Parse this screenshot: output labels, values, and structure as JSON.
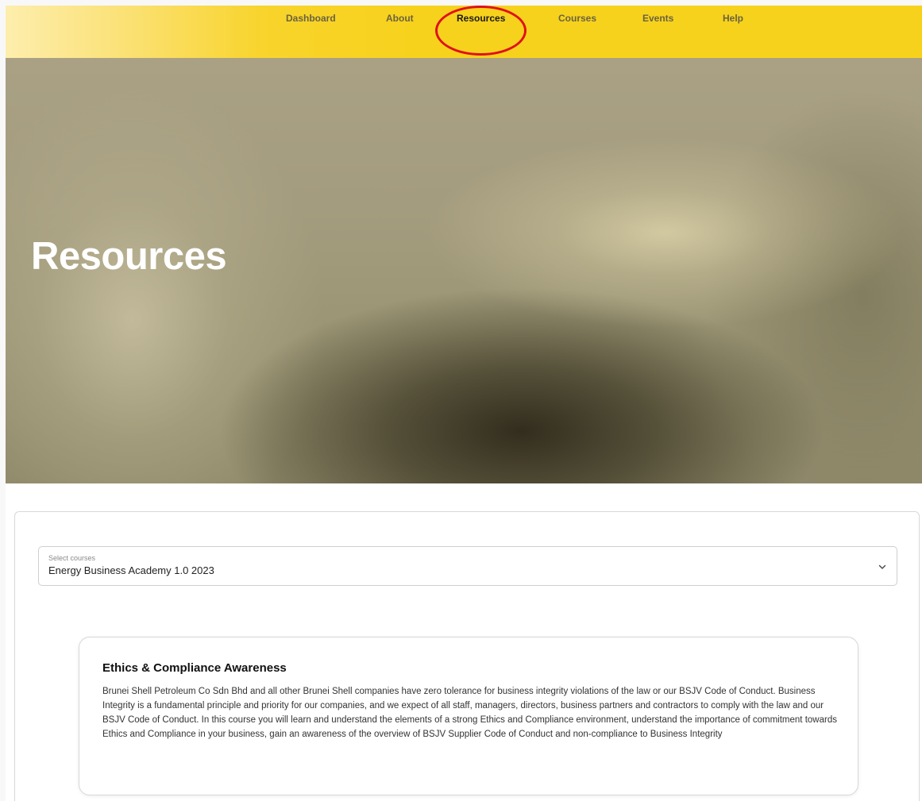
{
  "nav": {
    "items": [
      {
        "label": "Dashboard",
        "active": false
      },
      {
        "label": "About",
        "active": false
      },
      {
        "label": "Resources",
        "active": true
      },
      {
        "label": "Courses",
        "active": false
      },
      {
        "label": "Events",
        "active": false
      },
      {
        "label": "Help",
        "active": false
      }
    ]
  },
  "hero": {
    "title": "Resources"
  },
  "course_select": {
    "label": "Select courses",
    "value": "Energy Business Academy 1.0 2023",
    "icon": "chevron-down-icon"
  },
  "resource_card": {
    "title": "Ethics & Compliance Awareness",
    "description": "Brunei Shell Petroleum Co Sdn Bhd and all other Brunei Shell companies have zero tolerance for business integrity violations of the law or our BSJV Code of Conduct. Business Integrity is a fundamental principle and priority for our companies, and we expect of all staff, managers, directors, business partners and contractors to comply with the law and our BSJV Code of Conduct. In this course you will learn and understand the elements of a strong Ethics and Compliance environment, understand the importance of commitment towards Ethics and Compliance in your business, gain an awareness of the overview of BSJV Supplier Code of Conduct and non-compliance to Business Integrity"
  },
  "colors": {
    "nav_yellow": "#f7d21c",
    "highlight_red": "#e0101a"
  }
}
